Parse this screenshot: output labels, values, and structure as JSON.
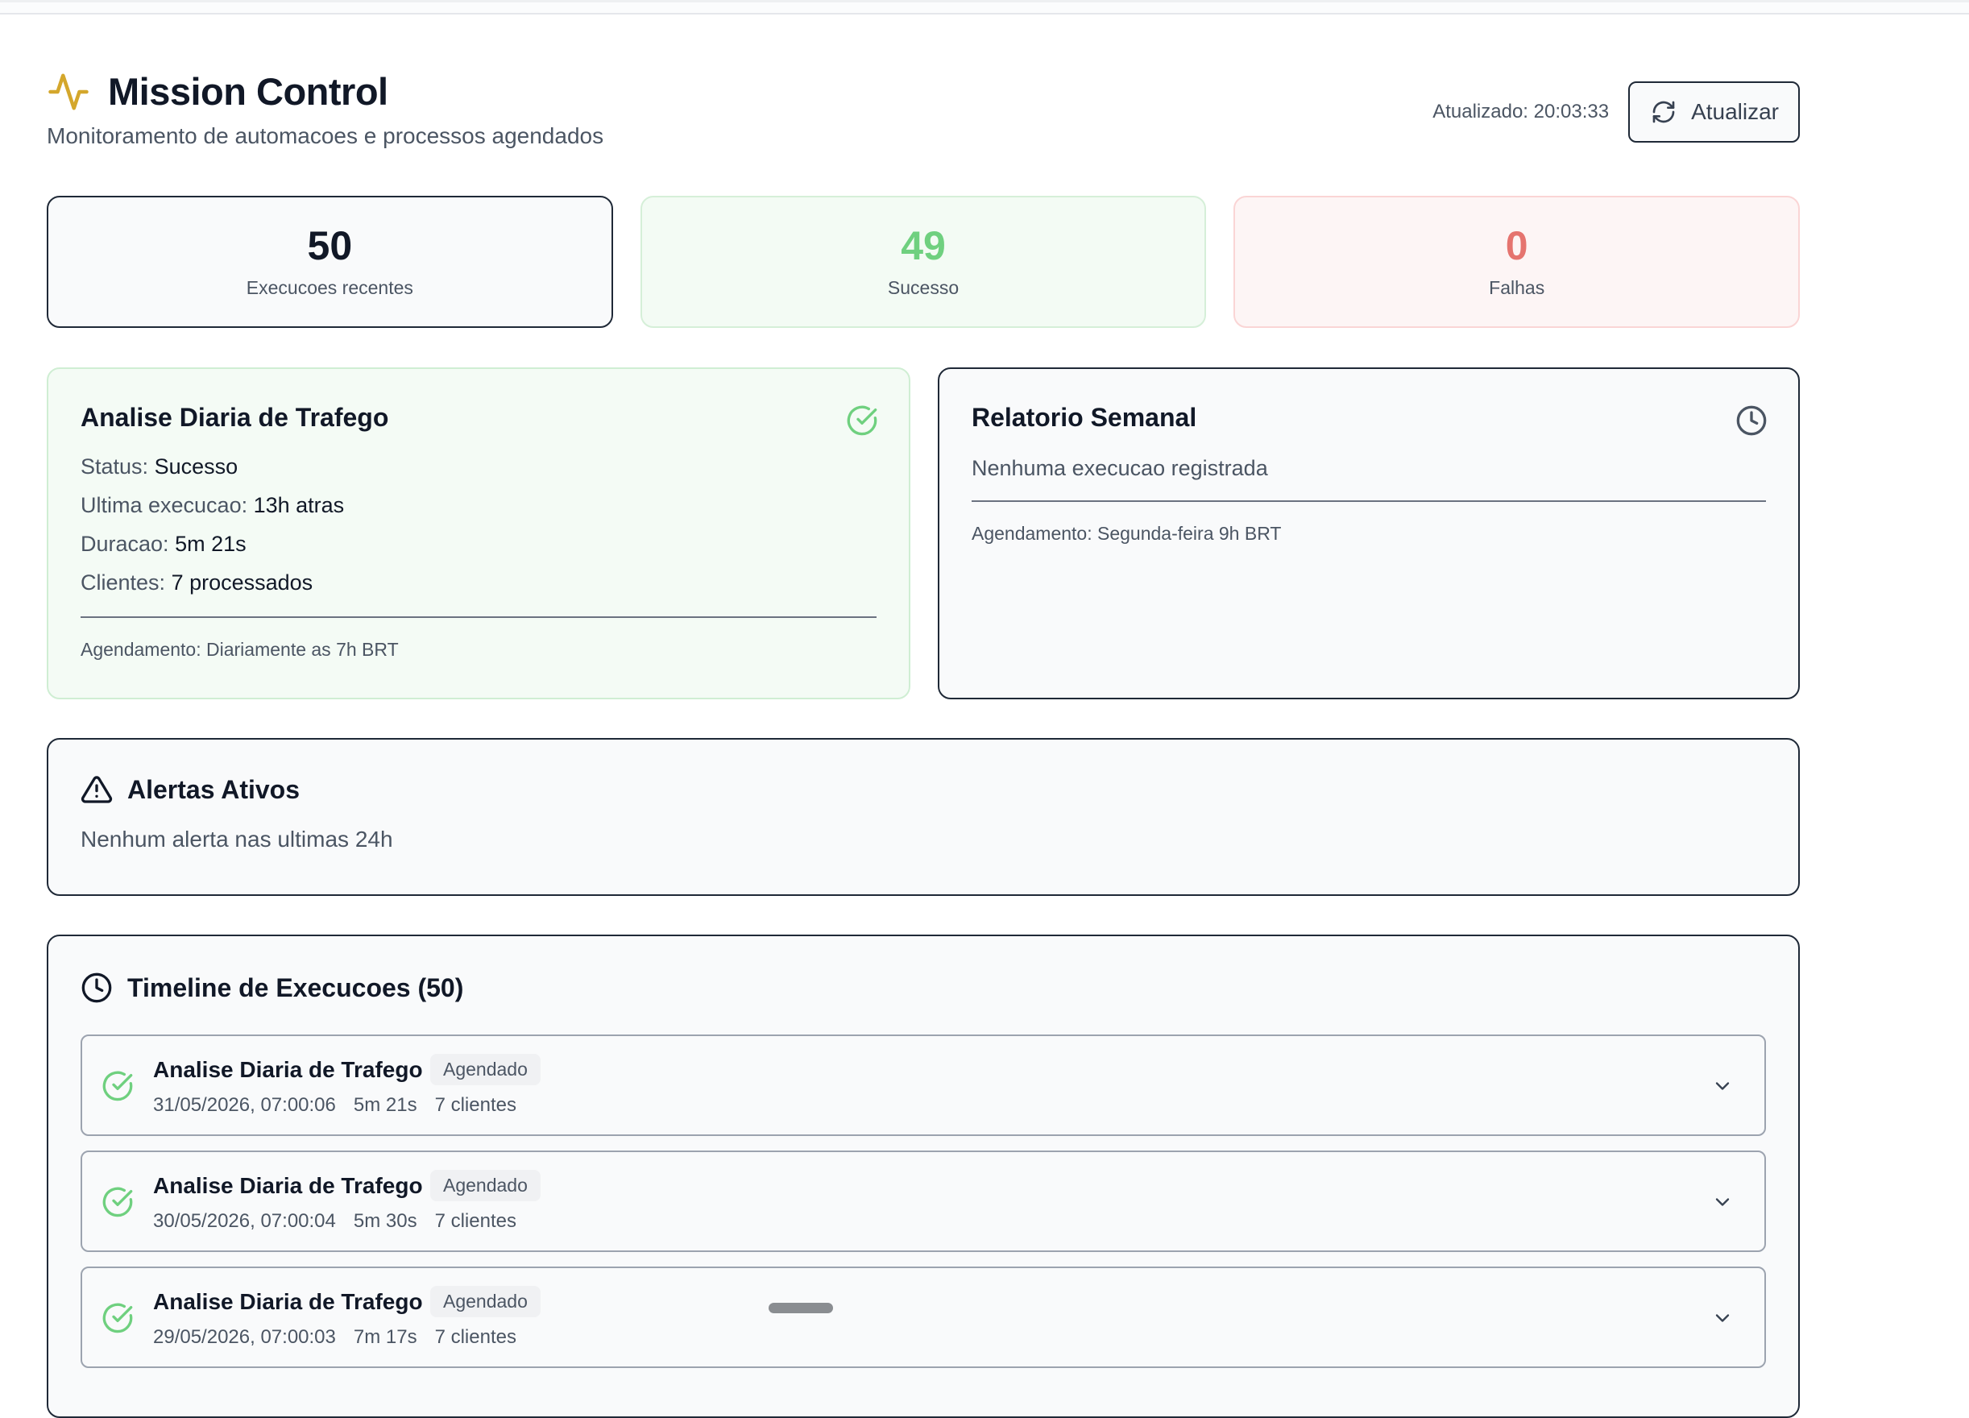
{
  "header": {
    "title": "Mission Control",
    "subtitle": "Monitoramento de automacoes e processos agendados",
    "updated_label": "Atualizado: 20:03:33",
    "refresh_label": "Atualizar",
    "icon": "activity-icon",
    "accent_color": "#d4a72c"
  },
  "stats": [
    {
      "value": "50",
      "label": "Execucoes recentes"
    },
    {
      "value": "49",
      "label": "Sucesso",
      "color": "#6fd07f"
    },
    {
      "value": "0",
      "label": "Falhas",
      "color": "#e5746f"
    }
  ],
  "jobs": [
    {
      "title": "Analise Diaria de Trafego",
      "status_icon": "check-circle-icon",
      "lines": [
        {
          "key": "Status:",
          "value": "Sucesso"
        },
        {
          "key": "Ultima execucao:",
          "value": "13h atras"
        },
        {
          "key": "Duracao:",
          "value": "5m 21s"
        },
        {
          "key": "Clientes:",
          "value": "7 processados"
        }
      ],
      "schedule": "Agendamento: Diariamente as 7h BRT"
    },
    {
      "title": "Relatorio Semanal",
      "status_icon": "clock-icon",
      "empty": "Nenhuma execucao registrada",
      "schedule": "Agendamento: Segunda-feira 9h BRT"
    }
  ],
  "alerts": {
    "title": "Alertas Ativos",
    "empty": "Nenhum alerta nas ultimas 24h"
  },
  "timeline": {
    "title": "Timeline de Execucoes (50)",
    "items": [
      {
        "name": "Analise Diaria de Trafego",
        "badge": "Agendado",
        "date": "31/05/2026, 07:00:06",
        "duration": "5m 21s",
        "clients": "7 clientes"
      },
      {
        "name": "Analise Diaria de Trafego",
        "badge": "Agendado",
        "date": "30/05/2026, 07:00:04",
        "duration": "5m 30s",
        "clients": "7 clientes"
      },
      {
        "name": "Analise Diaria de Trafego",
        "badge": "Agendado",
        "date": "29/05/2026, 07:00:03",
        "duration": "7m 17s",
        "clients": "7 clientes"
      }
    ]
  }
}
